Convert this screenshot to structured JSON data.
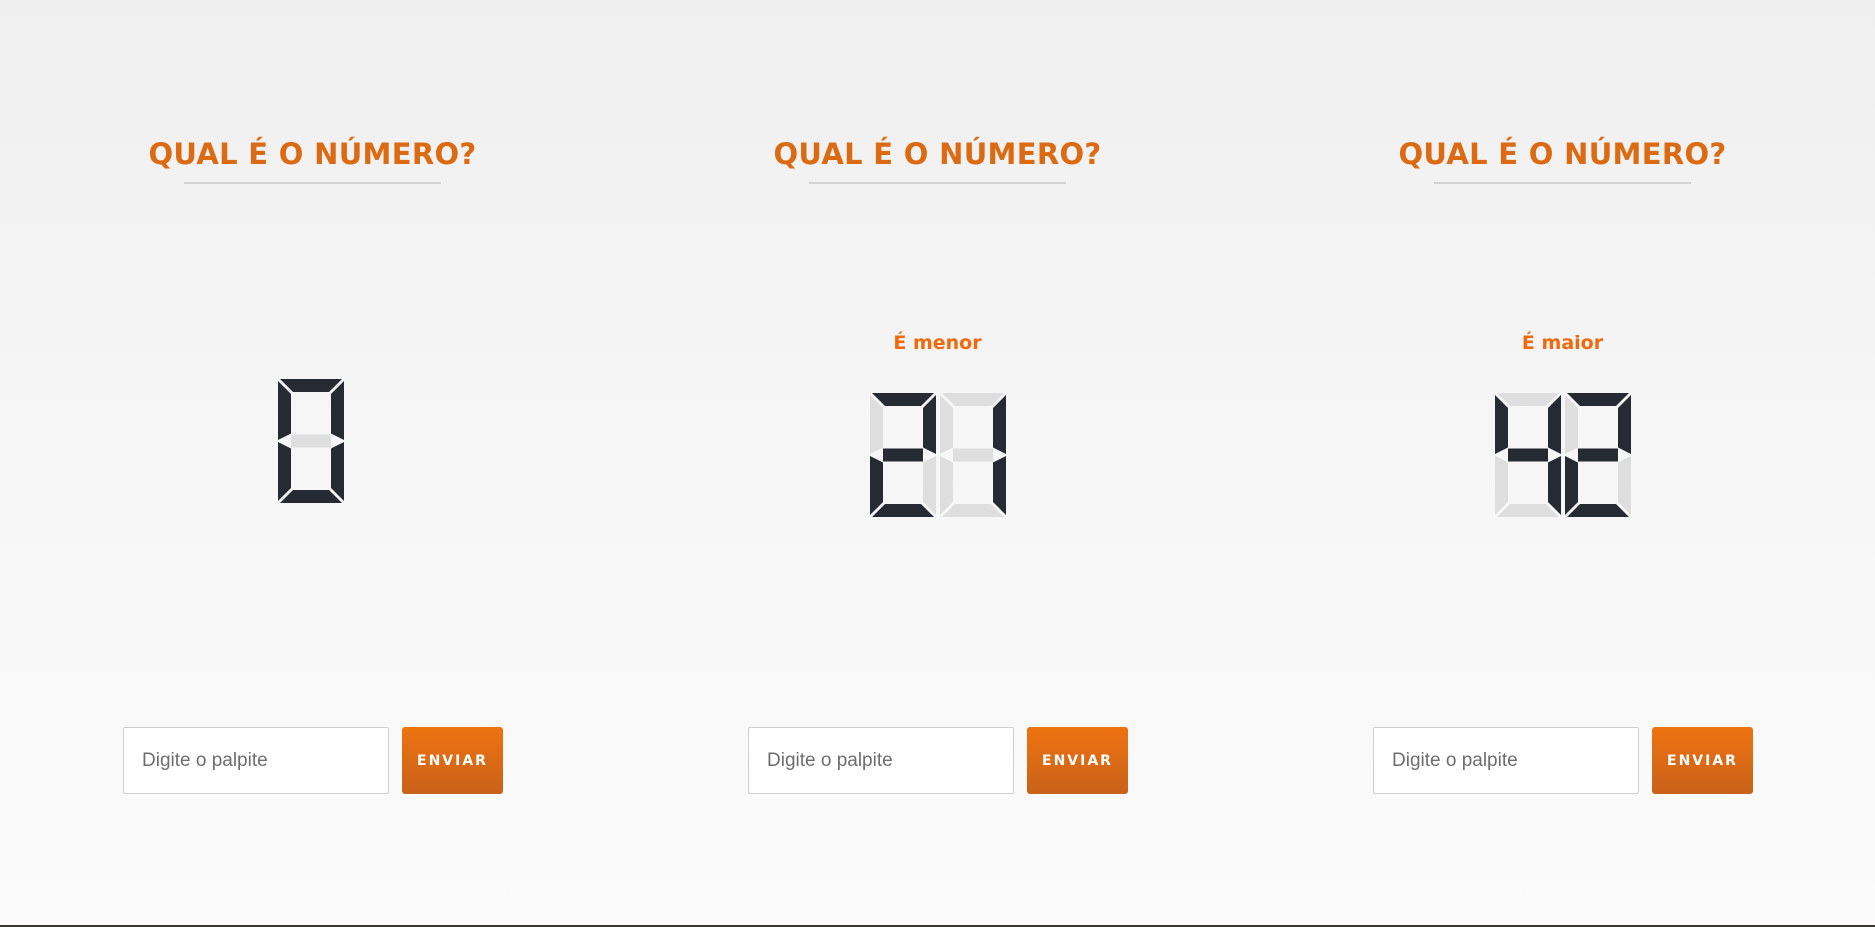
{
  "games": [
    {
      "title": "QUAL É O NÚMERO?",
      "hint": "",
      "display_value": "0",
      "input": {
        "placeholder": "Digite o palpite",
        "value": ""
      },
      "button_label": "ENVIAR"
    },
    {
      "title": "QUAL É O NÚMERO?",
      "hint": "É menor",
      "display_value": "21",
      "input": {
        "placeholder": "Digite o palpite",
        "value": ""
      },
      "button_label": "ENVIAR"
    },
    {
      "title": "QUAL É O NÚMERO?",
      "hint": "É maior",
      "display_value": "42",
      "input": {
        "placeholder": "Digite o palpite",
        "value": ""
      },
      "button_label": "ENVIAR"
    }
  ],
  "colors": {
    "accent": "#dc6a12",
    "hint": "#f06a0d",
    "segment_on": "#262a33",
    "segment_off": "#dedede"
  }
}
